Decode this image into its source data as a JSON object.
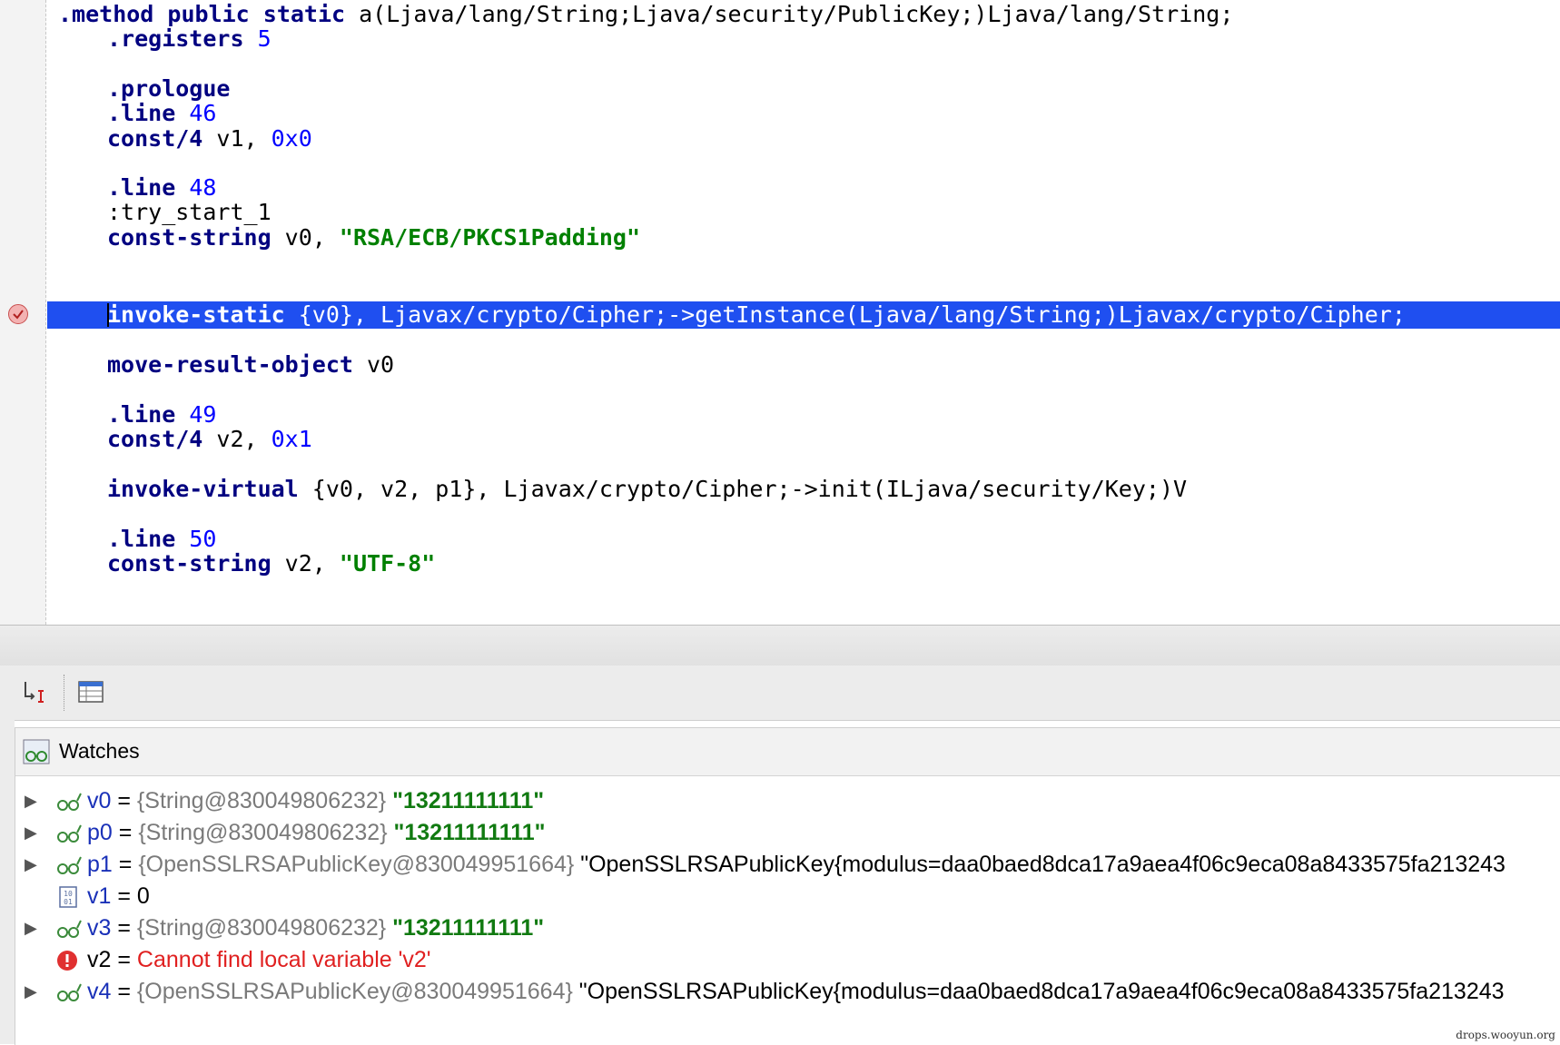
{
  "editor": {
    "lines": [
      {
        "seg": [
          {
            "t": ".method public static",
            "c": "kw"
          },
          {
            "t": " a(Ljava/lang/String;Ljava/security/PublicKey;)Ljava/lang/String;"
          }
        ]
      },
      {
        "seg": [
          {
            "t": ".registers",
            "c": "kw"
          },
          {
            "t": " 5",
            "c": "num"
          }
        ]
      },
      {
        "seg": [
          {
            "t": ".prologue",
            "c": "kw"
          }
        ]
      },
      {
        "seg": [
          {
            "t": ".line",
            "c": "kw"
          },
          {
            "t": " 46",
            "c": "num"
          }
        ]
      },
      {
        "seg": [
          {
            "t": "const/4",
            "c": "kw"
          },
          {
            "t": " v1, "
          },
          {
            "t": "0x0",
            "c": "num"
          }
        ]
      },
      {
        "seg": [
          {
            "t": ".line",
            "c": "kw"
          },
          {
            "t": " 48",
            "c": "num"
          }
        ]
      },
      {
        "seg": [
          {
            "t": ":try_start_1"
          }
        ]
      },
      {
        "seg": [
          {
            "t": "const-string",
            "c": "kw"
          },
          {
            "t": " v0, "
          },
          {
            "t": "\"RSA/ECB/PKCS1Padding\"",
            "c": "str"
          }
        ]
      },
      {
        "seg": [
          {
            "t": "invoke-static",
            "c": "kw"
          },
          {
            "t": " {v0}, Ljavax/crypto/Cipher;->getInstance(Ljava/lang/String;)Ljavax/crypto/Cipher;"
          }
        ]
      },
      {
        "seg": [
          {
            "t": "move-result-object",
            "c": "kw"
          },
          {
            "t": " v0"
          }
        ]
      },
      {
        "seg": [
          {
            "t": ".line",
            "c": "kw"
          },
          {
            "t": " 49",
            "c": "num"
          }
        ]
      },
      {
        "seg": [
          {
            "t": "const/4",
            "c": "kw"
          },
          {
            "t": " v2, "
          },
          {
            "t": "0x1",
            "c": "num"
          }
        ]
      },
      {
        "seg": [
          {
            "t": "invoke-virtual",
            "c": "kw"
          },
          {
            "t": " {v0, v2, p1}, Ljavax/crypto/Cipher;->init(ILjava/security/Key;)V"
          }
        ]
      },
      {
        "seg": [
          {
            "t": ".line",
            "c": "kw"
          },
          {
            "t": " 50",
            "c": "num"
          }
        ]
      },
      {
        "seg": [
          {
            "t": "const-string",
            "c": "kw"
          },
          {
            "t": " v2, "
          },
          {
            "t": "\"UTF-8\"",
            "c": "str"
          }
        ]
      }
    ],
    "highlight_color": "#1f4ff0",
    "breakpoint_icon": "breakpoint-check-icon"
  },
  "toolbar": {
    "icons": [
      "step-into-cursor-icon",
      "table-view-icon"
    ]
  },
  "watches": {
    "title": "Watches",
    "title_icon": "watches-glasses-icon",
    "rows": [
      {
        "name": "v0",
        "eq": "=",
        "type": "{String@830049806232}",
        "value": "\"13211111111\"",
        "kind": "string",
        "icon": "watch-glasses-icon",
        "expandable": true
      },
      {
        "name": "p0",
        "eq": "=",
        "type": "{String@830049806232}",
        "value": "\"13211111111\"",
        "kind": "string",
        "icon": "watch-glasses-icon",
        "expandable": true
      },
      {
        "name": "p1",
        "eq": "=",
        "type": "{OpenSSLRSAPublicKey@830049951664}",
        "value": "\"OpenSSLRSAPublicKey{modulus=daa0baed8dca17a9aea4f06c9eca08a8433575fa213243",
        "kind": "plain",
        "icon": "watch-glasses-icon",
        "expandable": true
      },
      {
        "name": "v1",
        "eq": "=",
        "type": "",
        "value": "0",
        "kind": "plain",
        "icon": "primitive-binary-icon",
        "expandable": false
      },
      {
        "name": "v3",
        "eq": "=",
        "type": "{String@830049806232}",
        "value": "\"13211111111\"",
        "kind": "string",
        "icon": "watch-glasses-icon",
        "expandable": true
      },
      {
        "name": "v2",
        "eq": "=",
        "type": "",
        "value": "Cannot find local variable 'v2'",
        "kind": "error",
        "icon": "error-icon",
        "expandable": false
      },
      {
        "name": "v4",
        "eq": "=",
        "type": "{OpenSSLRSAPublicKey@830049951664}",
        "value": "\"OpenSSLRSAPublicKey{modulus=daa0baed8dca17a9aea4f06c9eca08a8433575fa213243",
        "kind": "plain",
        "icon": "watch-glasses-icon",
        "expandable": true
      }
    ]
  },
  "watermark": "drops.wooyun.org"
}
